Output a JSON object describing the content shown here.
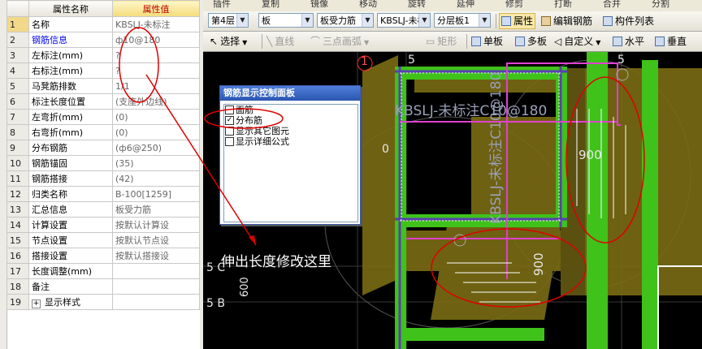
{
  "toolbar_top": {
    "items": [
      "插件",
      "复制",
      "镜像",
      "移动",
      "旋转",
      "延伸",
      "修剪",
      "打断",
      "合并",
      "分割"
    ]
  },
  "toolbar_main": {
    "floor": "第4层",
    "component": "板",
    "type": "板受力筋",
    "name": "KBSLJ-未标",
    "layer": "分层板1",
    "btn_props": "属性",
    "btn_edit": "编辑钢筋",
    "btn_list": "构件列表"
  },
  "toolbar_draw": {
    "select": "选择",
    "line": "直线",
    "arc": "三点画弧",
    "rect": "矩形",
    "single": "单板",
    "multi": "多板",
    "custom": "自定义",
    "horizontal": "水平",
    "vertical": "垂直"
  },
  "properties": {
    "header_name": "属性名称",
    "header_value": "属性值",
    "rows": [
      {
        "num": "1",
        "name": "名称",
        "value": "KBSLJ-未标注",
        "blue": false
      },
      {
        "num": "2",
        "name": "钢筋信息",
        "value": "ф10@180",
        "blue": true
      },
      {
        "num": "3",
        "name": "左标注(mm)",
        "value": "?",
        "blue": false
      },
      {
        "num": "4",
        "name": "右标注(mm)",
        "value": "?",
        "blue": false
      },
      {
        "num": "5",
        "name": "马凳筋排数",
        "value": "1/1",
        "blue": false
      },
      {
        "num": "6",
        "name": "标注长度位置",
        "value": "(支座外边线)",
        "blue": false
      },
      {
        "num": "7",
        "name": "左弯折(mm)",
        "value": "(0)",
        "blue": false
      },
      {
        "num": "8",
        "name": "右弯折(mm)",
        "value": "(0)",
        "blue": false
      },
      {
        "num": "9",
        "name": "分布钢筋",
        "value": "(ф6@250)",
        "blue": false
      },
      {
        "num": "10",
        "name": "钢筋锚固",
        "value": "(35)",
        "blue": false
      },
      {
        "num": "11",
        "name": "钢筋搭接",
        "value": "(42)",
        "blue": false
      },
      {
        "num": "12",
        "name": "归类名称",
        "value": "B-100[1259]",
        "blue": false
      },
      {
        "num": "13",
        "name": "汇总信息",
        "value": "板受力筋",
        "blue": false
      },
      {
        "num": "14",
        "name": "计算设置",
        "value": "按默认计算设",
        "blue": false
      },
      {
        "num": "15",
        "name": "节点设置",
        "value": "按默认节点设",
        "blue": false
      },
      {
        "num": "16",
        "name": "搭接设置",
        "value": "按默认搭接设",
        "blue": false
      },
      {
        "num": "17",
        "name": "长度调整(mm)",
        "value": "",
        "blue": false
      },
      {
        "num": "18",
        "name": "备注",
        "value": "",
        "blue": false
      },
      {
        "num": "19",
        "name": "显示样式",
        "value": "",
        "blue": false
      }
    ]
  },
  "rebar_panel": {
    "title": "钢筋显示控制面板",
    "items": [
      {
        "label": "面筋",
        "checked": false
      },
      {
        "label": "分布筋",
        "checked": true
      },
      {
        "label": "显示其它图元",
        "checked": false
      },
      {
        "label": "显示详细公式",
        "checked": false
      }
    ]
  },
  "canvas": {
    "axis_labels": [
      "1",
      "5",
      "5",
      "0",
      "5 C",
      "5 B"
    ],
    "dimensions": [
      "900",
      "900",
      "600"
    ],
    "rebar_label": "KBSLJ-未标注C10@180",
    "rebar_label_vertical": "KBSLJ-未标注C10@180"
  },
  "annotation": {
    "note": "伸出长度修改这里"
  },
  "colors": {
    "beam_green": "#3fc21a",
    "slab_olive": "#8a7d1a",
    "rebar_white": "#ffffff",
    "callout_red": "#e00000",
    "canvas_bg": "#000000",
    "highlight_blue": "#3b5bb0"
  }
}
